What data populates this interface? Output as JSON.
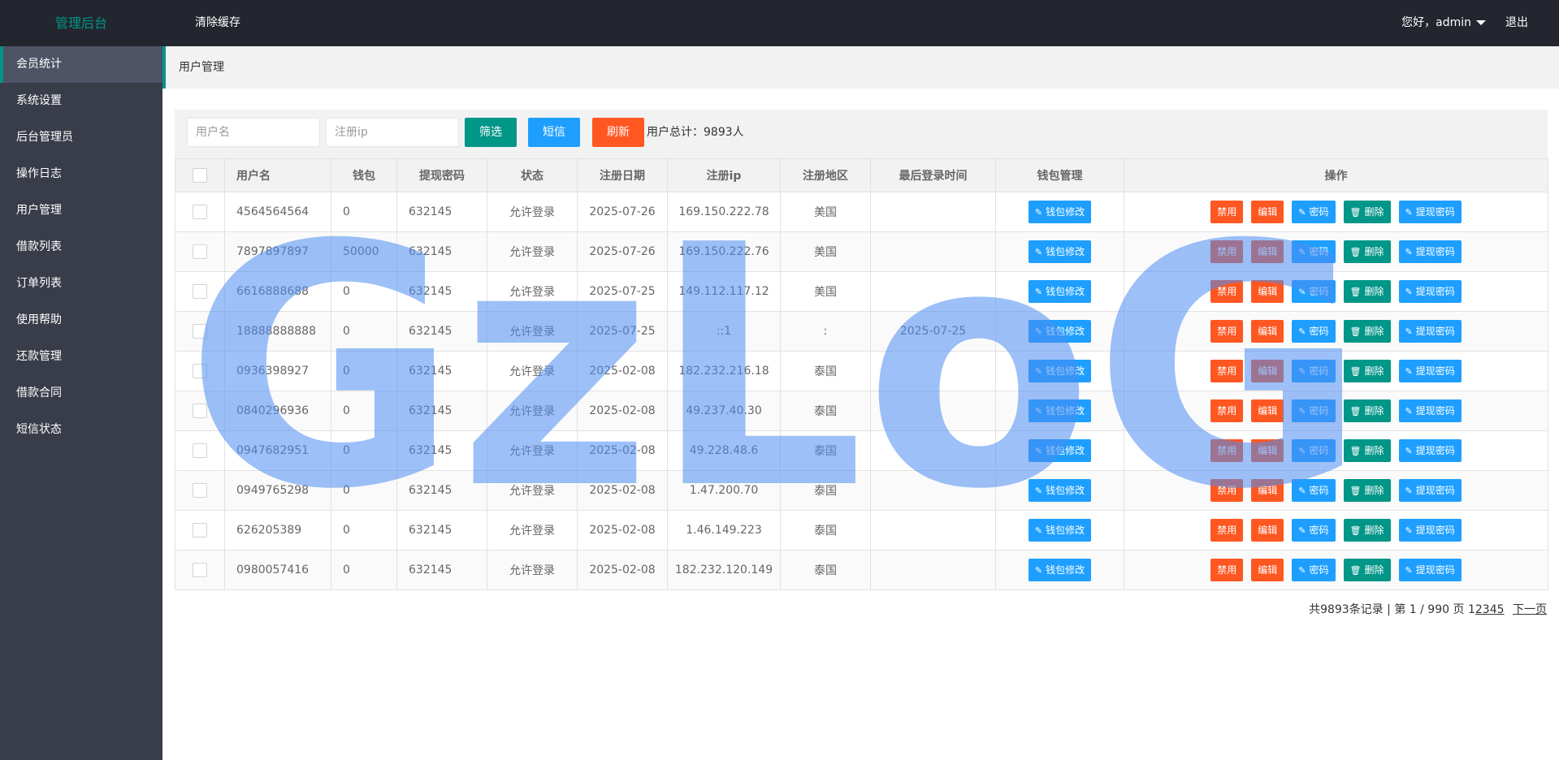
{
  "header": {
    "logo": "管理后台",
    "clear_cache": "清除缓存",
    "greeting": "您好，admin",
    "logout": "退出"
  },
  "sidebar": {
    "items": [
      {
        "label": "会员统计"
      },
      {
        "label": "系统设置"
      },
      {
        "label": "后台管理员"
      },
      {
        "label": "操作日志"
      },
      {
        "label": "用户管理"
      },
      {
        "label": "借款列表"
      },
      {
        "label": "订单列表"
      },
      {
        "label": "使用帮助"
      },
      {
        "label": "还款管理"
      },
      {
        "label": "借款合同"
      },
      {
        "label": "短信状态"
      }
    ]
  },
  "breadcrumb": "用户管理",
  "search": {
    "username_placeholder": "用户名",
    "ip_placeholder": "注册ip",
    "filter_label": "筛选",
    "sms_label": "短信",
    "refresh_label": "刷新",
    "total_text": "用户总计：9893人"
  },
  "table": {
    "headers": [
      "用户名",
      "钱包",
      "提现密码",
      "状态",
      "注册日期",
      "注册ip",
      "注册地区",
      "最后登录时间",
      "钱包管理",
      "操作"
    ],
    "wallet_button": "钱包修改",
    "actions": {
      "ban": "禁用",
      "edit": "编辑",
      "password": "密码",
      "delete": "删除",
      "withdraw_password": "提现密码"
    },
    "rows": [
      {
        "username": "4564564564",
        "wallet": "0",
        "withdraw_pwd": "632145",
        "status": "允许登录",
        "reg_date": "2025-07-26",
        "reg_ip": "169.150.222.78",
        "region": "美国",
        "last_login": ""
      },
      {
        "username": "7897897897",
        "wallet": "50000",
        "withdraw_pwd": "632145",
        "status": "允许登录",
        "reg_date": "2025-07-26",
        "reg_ip": "169.150.222.76",
        "region": "美国",
        "last_login": ""
      },
      {
        "username": "6616888688",
        "wallet": "0",
        "withdraw_pwd": "632145",
        "status": "允许登录",
        "reg_date": "2025-07-25",
        "reg_ip": "149.112.117.12",
        "region": "美国",
        "last_login": ""
      },
      {
        "username": "18888888888",
        "wallet": "0",
        "withdraw_pwd": "632145",
        "status": "允许登录",
        "reg_date": "2025-07-25",
        "reg_ip": "::1",
        "region": ":",
        "last_login": "2025-07-25"
      },
      {
        "username": "0936398927",
        "wallet": "0",
        "withdraw_pwd": "632145",
        "status": "允许登录",
        "reg_date": "2025-02-08",
        "reg_ip": "182.232.216.18",
        "region": "泰国",
        "last_login": ""
      },
      {
        "username": "0840296936",
        "wallet": "0",
        "withdraw_pwd": "632145",
        "status": "允许登录",
        "reg_date": "2025-02-08",
        "reg_ip": "49.237.40.30",
        "region": "泰国",
        "last_login": ""
      },
      {
        "username": "0947682951",
        "wallet": "0",
        "withdraw_pwd": "632145",
        "status": "允许登录",
        "reg_date": "2025-02-08",
        "reg_ip": "49.228.48.6",
        "region": "泰国",
        "last_login": ""
      },
      {
        "username": "0949765298",
        "wallet": "0",
        "withdraw_pwd": "632145",
        "status": "允许登录",
        "reg_date": "2025-02-08",
        "reg_ip": "1.47.200.70",
        "region": "泰国",
        "last_login": ""
      },
      {
        "username": "626205389",
        "wallet": "0",
        "withdraw_pwd": "632145",
        "status": "允许登录",
        "reg_date": "2025-02-08",
        "reg_ip": "1.46.149.223",
        "region": "泰国",
        "last_login": ""
      },
      {
        "username": "0980057416",
        "wallet": "0",
        "withdraw_pwd": "632145",
        "status": "允许登录",
        "reg_date": "2025-02-08",
        "reg_ip": "182.232.120.149",
        "region": "泰国",
        "last_login": ""
      }
    ]
  },
  "pagination": {
    "summary": "共9893条记录 | 第 1 / 990 页",
    "current": "1",
    "pages": [
      "2",
      "3",
      "4",
      "5"
    ],
    "next": "下一页"
  },
  "watermark": {
    "text": "GzLoG",
    "color": "#4a8cf0"
  },
  "colors": {
    "topbar": "#23262e",
    "sidebar": "#393d49",
    "accent": "#009688",
    "blue": "#1e9fff",
    "orange": "#ff5722"
  }
}
